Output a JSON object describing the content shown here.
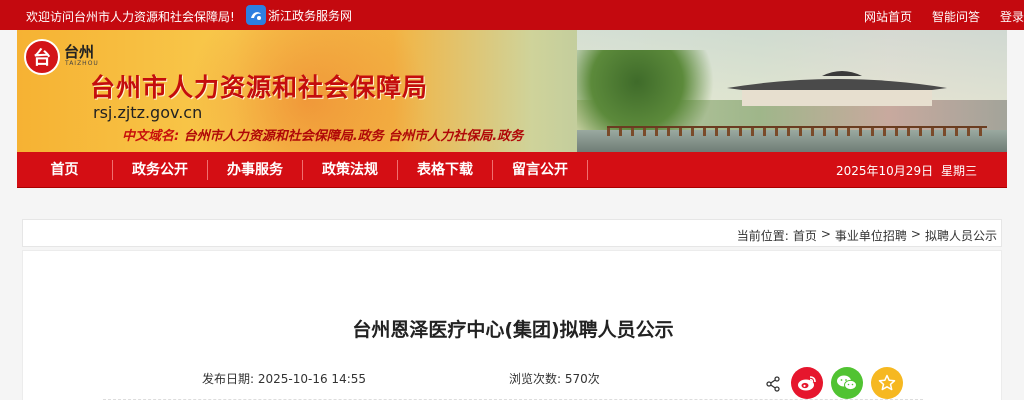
{
  "topbar": {
    "welcome": "欢迎访问台州市人力资源和社会保障局!",
    "zj_link": "浙江政务服务网",
    "links": [
      "网站首页",
      "智能问答",
      "登录"
    ]
  },
  "banner": {
    "logo_name": "台州",
    "logo_sub": "TAIZHOU",
    "title": "台州市人力资源和社会保障局",
    "domain": "rsj.zjtz.gov.cn",
    "cn_domain_label": "中文域名:",
    "cn_domain_value": "台州市人力资源和社会保障局.政务  台州市人力社保局.政务"
  },
  "nav": {
    "items": [
      "首页",
      "政务公开",
      "办事服务",
      "政策法规",
      "表格下载",
      "留言公开"
    ],
    "date": "2025年10月29日",
    "weekday": "星期三"
  },
  "breadcrumb": {
    "label": "当前位置:",
    "items": [
      "首页",
      ">",
      "事业单位招聘",
      ">",
      "拟聘人员公示"
    ]
  },
  "article": {
    "title": "台州恩泽医疗中心(集团)拟聘人员公示",
    "publish_label": "发布日期:",
    "publish_date": "2025-10-16 14:55",
    "views_label": "浏览次数:",
    "views": "570次"
  },
  "colors": {
    "brand_red": "#c4090f",
    "nav_red": "#d40e14",
    "weibo": "#e6162d",
    "wechat": "#51c332",
    "favorite": "#f6b821"
  },
  "icons": [
    "zhejiang-gov-icon",
    "share-icon",
    "weibo-icon",
    "wechat-icon",
    "favorite-icon"
  ]
}
